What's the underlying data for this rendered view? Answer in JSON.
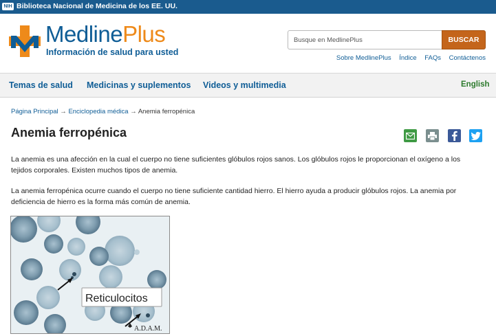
{
  "nih_bar": {
    "logo_text": "NIH",
    "text": "Biblioteca Nacional de Medicina de los EE. UU."
  },
  "header": {
    "logo_brand_a": "Medline",
    "logo_brand_b": "Plus",
    "tagline": "Información de salud para usted",
    "search": {
      "placeholder": "Busque en MedlinePlus",
      "button_label": "BUSCAR"
    },
    "utility_links": [
      "Sobre MedlinePlus",
      "Índice",
      "FAQs",
      "Contáctenos"
    ]
  },
  "nav": {
    "items": [
      "Temas de salud",
      "Medicinas y suplementos",
      "Videos y multimedia"
    ],
    "language_link": "English"
  },
  "breadcrumb": {
    "home": "Página Principal",
    "arrow": "→",
    "section": "Enciclopedia médica",
    "current": "Anemia ferropénica"
  },
  "article": {
    "title": "Anemia ferropénica",
    "paragraphs": [
      "La anemia es una afección en la cual el cuerpo no tiene suficientes glóbulos rojos sanos. Los glóbulos rojos le proporcionan el oxígeno a los tejidos corporales. Existen muchos tipos de anemia.",
      "La anemia ferropénica ocurre cuando el cuerpo no tiene suficiente cantidad hierro. El hierro ayuda a producir glóbulos rojos. La anemia por deficiencia de hierro es la forma más común de anemia."
    ]
  },
  "share_icons": [
    "email-icon",
    "print-icon",
    "facebook-icon",
    "twitter-icon"
  ],
  "figure": {
    "label": "Reticulocitos",
    "credit": "A.D.A.M."
  },
  "colors": {
    "nih_bar": "#1a5b8e",
    "brand_blue": "#0f5d96",
    "brand_orange": "#ee8a1a",
    "search_button": "#c4651b",
    "english_link": "#2c7a2c"
  }
}
